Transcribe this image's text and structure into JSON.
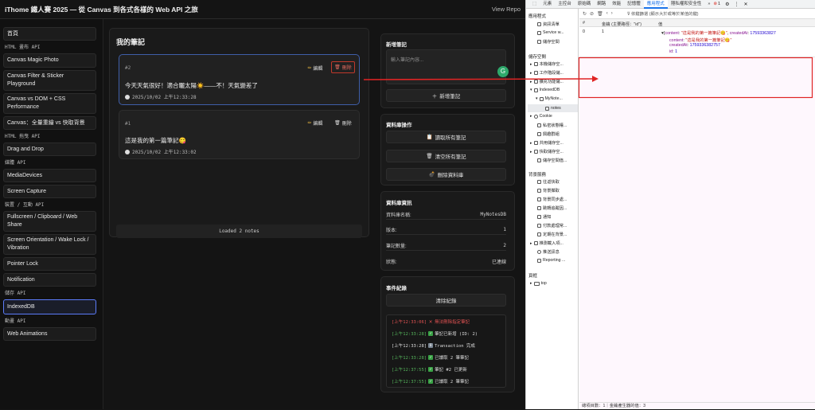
{
  "page": {
    "title": "iThome 鐵人賽 2025 — 從 Canvas 到各式各樣的 Web API 之旅",
    "repo_link": "View Repo"
  },
  "sidebar": {
    "home": "首頁",
    "sections": [
      {
        "heading": "HTML 畫布 API",
        "items": [
          "Canvas Magic Photo",
          "Canvas Filter & Sticker Playground",
          "Canvas vs DOM + CSS Performance",
          "Canvas：全量重繪 vs 快取背景"
        ]
      },
      {
        "heading": "HTML 拖曳 API",
        "items": [
          "Drag and Drop"
        ]
      },
      {
        "heading": "媒體 API",
        "items": [
          "MediaDevices",
          "Screen Capture"
        ]
      },
      {
        "heading": "裝置 / 互動 API",
        "items": [
          "Fullscreen / Clipboard / Web Share",
          "Screen Orientation / Wake Lock / Vibration",
          "Pointer Lock",
          "Notification"
        ]
      },
      {
        "heading": "儲存 API",
        "items": [
          "IndexedDB"
        ]
      },
      {
        "heading": "動畫 API",
        "items": [
          "Web Animations"
        ]
      }
    ],
    "active": "IndexedDB"
  },
  "notes_panel": {
    "title": "我的筆記",
    "edit_label": "編輯",
    "delete_label": "刪除",
    "notes": [
      {
        "id": "#2",
        "content": "今天天氣很好！適合曬太陽☀️——不！天氣變差了",
        "date": "2025/10/02 上午12:33:28"
      },
      {
        "id": "#1",
        "content": "這是我的第一篇筆記😋",
        "date": "2025/10/02 上午12:33:02"
      }
    ],
    "status": "Loaded 2 notes"
  },
  "new_note": {
    "title": "新增筆記",
    "placeholder": "輸入筆記內容...",
    "add_button": "新增筆記"
  },
  "db_ops": {
    "title": "資料庫操作",
    "read_all": "讀取所有筆記",
    "clear_all": "清空所有筆記",
    "delete_db": "刪除資料庫"
  },
  "db_info": {
    "title": "資料庫資訊",
    "rows": [
      {
        "label": "資料庫名稱:",
        "value": "MyNotesDB"
      },
      {
        "label": "版本:",
        "value": "1"
      },
      {
        "label": "筆記數量:",
        "value": "2"
      },
      {
        "label": "狀態:",
        "value": "已連線"
      }
    ]
  },
  "event_log": {
    "title": "事件紀錄",
    "clear_button": "清除紀錄",
    "entries": [
      {
        "time": "[上午12:33:06]",
        "icon": "cross-mark",
        "text": "無法刪除指定筆記",
        "level": "error"
      },
      {
        "time": "[上午12:33:28]",
        "icon": "check-mark",
        "text": "筆記已新增 (ID: 2)",
        "level": "ok"
      },
      {
        "time": "[上午12:33:28]",
        "icon": "info",
        "text": "Transaction 完成",
        "level": "info"
      },
      {
        "time": "[上午12:33:28]",
        "icon": "check-mark",
        "text": "已讀取 2 筆筆記",
        "level": "ok"
      },
      {
        "time": "[上午12:37:55]",
        "icon": "check-mark",
        "text": "筆記 #2 已更新",
        "level": "ok"
      },
      {
        "time": "[上午12:37:55]",
        "icon": "check-mark",
        "text": "已讀取 2 筆筆記",
        "level": "ok"
      }
    ]
  },
  "devtools": {
    "tabs": [
      "元素",
      "主控台",
      "原始碼",
      "網路",
      "效能",
      "記憶體",
      "應用程式",
      "隱私權和安全性"
    ],
    "active_tab": "應用程式",
    "error_count": "1",
    "sections": {
      "application": "應用程式",
      "application_items": [
        "資訊清單",
        "Service w...",
        "儲存空間"
      ],
      "storage": "儲存空間",
      "storage_items": [
        "本機儲存空...",
        "工作階段儲...",
        "擴充功能儲...",
        "IndexedDB",
        "MyNote...",
        "notes",
        "Cookie",
        "私密狀態權...",
        "興趣群組",
        "共用儲存空...",
        "快取儲存空...",
        "儲存空間值..."
      ],
      "background": "背景服務",
      "background_items": [
        "往返快取",
        "背景擷取",
        "背景同步處...",
        "跳轉追蹤因...",
        "通知",
        "付款處理常...",
        "定期在背景...",
        "推測載入項...",
        "推送訊息",
        "Reporting ..."
      ],
      "frames": "頁框",
      "frame_items": [
        "top"
      ]
    },
    "filter_placeholder": "依鍵篩選 (顯示大於或等於某值的鍵)",
    "columns": [
      "#",
      "金鑰 (主要路徑：\"id\")",
      "值"
    ],
    "row": {
      "index": "0",
      "key": "1",
      "summary_key1": "content",
      "summary_val1": "\"這是我的第一篇筆記😋\"",
      "summary_key2": "createdAt",
      "summary_val2": "17593363827",
      "content_key": "content",
      "content_val": "\"這是我的第一篇筆記😋\"",
      "created_key": "createdAt",
      "created_val": "1759336382757",
      "id_key": "id",
      "id_val": "1"
    },
    "footer": "總項目數：1｜金鑰產生器的值：3"
  },
  "colors": {
    "accent": "#5c7cfa",
    "danger": "#c0392b",
    "annotation_red": "#e02424",
    "devtools_blue": "#1a73e8"
  }
}
